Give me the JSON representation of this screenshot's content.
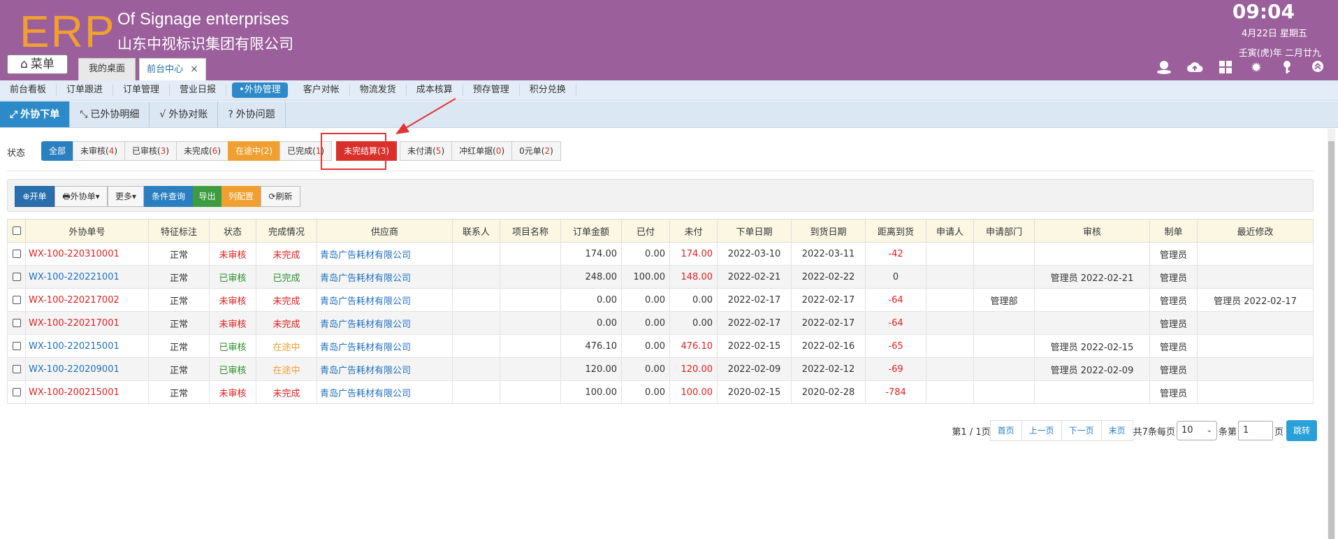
{
  "header": {
    "logo": "ERP",
    "company_en": "Of Signage enterprises",
    "company_cn": "山东中视标识集团有限公司",
    "time": "09:04",
    "date": "4月22日 星期五",
    "lunar": "壬寅(虎)年 二月廿九",
    "menu_label": "菜单",
    "tabs": [
      {
        "label": "我的桌面"
      },
      {
        "label": "前台中心",
        "close": "×"
      }
    ],
    "icons": [
      "user-icon",
      "cloud-icon",
      "grid-icon",
      "gear-icon",
      "key-icon",
      "collapse-icon"
    ]
  },
  "nav": {
    "items": [
      "前台看板",
      "订单跟进",
      "订单管理",
      "营业日报",
      "•外协管理",
      "客户对帐",
      "物流发货",
      "成本核算",
      "预存管理",
      "积分兑换"
    ]
  },
  "subnav": {
    "items": [
      "外协下单",
      "已外协明细",
      "外协对账",
      "外协问题"
    ]
  },
  "status": {
    "label": "状态",
    "buttons": [
      {
        "label": "全部",
        "count": ""
      },
      {
        "label": "未审核(",
        "count": "4",
        "close": ")"
      },
      {
        "label": "已审核(",
        "count": "3",
        "close": ")"
      },
      {
        "label": "未完成(",
        "count": "6",
        "close": ")"
      },
      {
        "label": "在途中(",
        "count": "2",
        "close": ")"
      },
      {
        "label": "已完成(",
        "count": "1",
        "close": ")"
      },
      {
        "label": "未完结算(",
        "count": "3",
        "close": ")"
      },
      {
        "label": "未付清(",
        "count": "5",
        "close": ")"
      },
      {
        "label": "冲红单据(",
        "count": "0",
        "close": ")"
      },
      {
        "label": "0元单(",
        "count": "2",
        "close": ")"
      }
    ]
  },
  "toolbar": {
    "open": "开单",
    "outsource": "外协单",
    "more": "更多",
    "query": "条件查询",
    "export": "导出",
    "columns": "列配置",
    "refresh": "刷新"
  },
  "table": {
    "headers": [
      "外协单号",
      "特征标注",
      "状态",
      "完成情况",
      "供应商",
      "联系人",
      "项目名称",
      "订单金额",
      "已付",
      "未付",
      "下单日期",
      "到货日期",
      "距离到货",
      "申请人",
      "申请部门",
      "审核",
      "制单",
      "最近修改"
    ],
    "rows": [
      {
        "no": "WX-100-220310001",
        "tag": "正常",
        "status": "未审核",
        "done": "未完成",
        "supplier": "青岛广告耗材有限公司",
        "contact": "",
        "project": "",
        "amount": "174.00",
        "paid": "0.00",
        "unpaid": "174.00",
        "order_date": "2022-03-10",
        "arrive_date": "2022-03-11",
        "distance": "-42",
        "applicant": "",
        "dept": "",
        "audit": "",
        "maker": "管理员",
        "modified": ""
      },
      {
        "no": "WX-100-220221001",
        "tag": "正常",
        "status": "已审核",
        "done": "已完成",
        "supplier": "青岛广告耗材有限公司",
        "contact": "",
        "project": "",
        "amount": "248.00",
        "paid": "100.00",
        "unpaid": "148.00",
        "order_date": "2022-02-21",
        "arrive_date": "2022-02-22",
        "distance": "0",
        "applicant": "",
        "dept": "",
        "audit": "管理员 2022-02-21",
        "maker": "管理员",
        "modified": ""
      },
      {
        "no": "WX-100-220217002",
        "tag": "正常",
        "status": "未审核",
        "done": "未完成",
        "supplier": "青岛广告耗材有限公司",
        "contact": "",
        "project": "",
        "amount": "0.00",
        "paid": "0.00",
        "unpaid": "0.00",
        "order_date": "2022-02-17",
        "arrive_date": "2022-02-17",
        "distance": "-64",
        "applicant": "",
        "dept": "管理部",
        "audit": "",
        "maker": "管理员",
        "modified": "管理员 2022-02-17"
      },
      {
        "no": "WX-100-220217001",
        "tag": "正常",
        "status": "未审核",
        "done": "未完成",
        "supplier": "青岛广告耗材有限公司",
        "contact": "",
        "project": "",
        "amount": "0.00",
        "paid": "0.00",
        "unpaid": "0.00",
        "order_date": "2022-02-17",
        "arrive_date": "2022-02-17",
        "distance": "-64",
        "applicant": "",
        "dept": "",
        "audit": "",
        "maker": "管理员",
        "modified": ""
      },
      {
        "no": "WX-100-220215001",
        "tag": "正常",
        "status": "已审核",
        "done": "在途中",
        "supplier": "青岛广告耗材有限公司",
        "contact": "",
        "project": "",
        "amount": "476.10",
        "paid": "0.00",
        "unpaid": "476.10",
        "order_date": "2022-02-15",
        "arrive_date": "2022-02-16",
        "distance": "-65",
        "applicant": "",
        "dept": "",
        "audit": "管理员 2022-02-15",
        "maker": "管理员",
        "modified": ""
      },
      {
        "no": "WX-100-220209001",
        "tag": "正常",
        "status": "已审核",
        "done": "在途中",
        "supplier": "青岛广告耗材有限公司",
        "contact": "",
        "project": "",
        "amount": "120.00",
        "paid": "0.00",
        "unpaid": "120.00",
        "order_date": "2022-02-09",
        "arrive_date": "2022-02-12",
        "distance": "-69",
        "applicant": "",
        "dept": "",
        "audit": "管理员 2022-02-09",
        "maker": "管理员",
        "modified": ""
      },
      {
        "no": "WX-100-200215001",
        "tag": "正常",
        "status": "未审核",
        "done": "未完成",
        "supplier": "青岛广告耗材有限公司",
        "contact": "",
        "project": "",
        "amount": "100.00",
        "paid": "0.00",
        "unpaid": "100.00",
        "order_date": "2020-02-15",
        "arrive_date": "2020-02-28",
        "distance": "-784",
        "applicant": "",
        "dept": "",
        "audit": "",
        "maker": "管理员",
        "modified": ""
      }
    ]
  },
  "pager": {
    "page_info": "第1 / 1页",
    "first": "首页",
    "prev": "上一页",
    "next": "下一页",
    "last": "末页",
    "total": "共7条每页",
    "page_size": "10",
    "unit": "条第",
    "page_input": "1",
    "page_suffix": "页",
    "jump": "跳转"
  },
  "colors": {
    "header_bg": "#9b5f9c",
    "logo": "#f0a030",
    "accent": "#2d8ac9",
    "red": "#e02020",
    "green": "#2a8f2a",
    "orange": "#f0a030"
  }
}
